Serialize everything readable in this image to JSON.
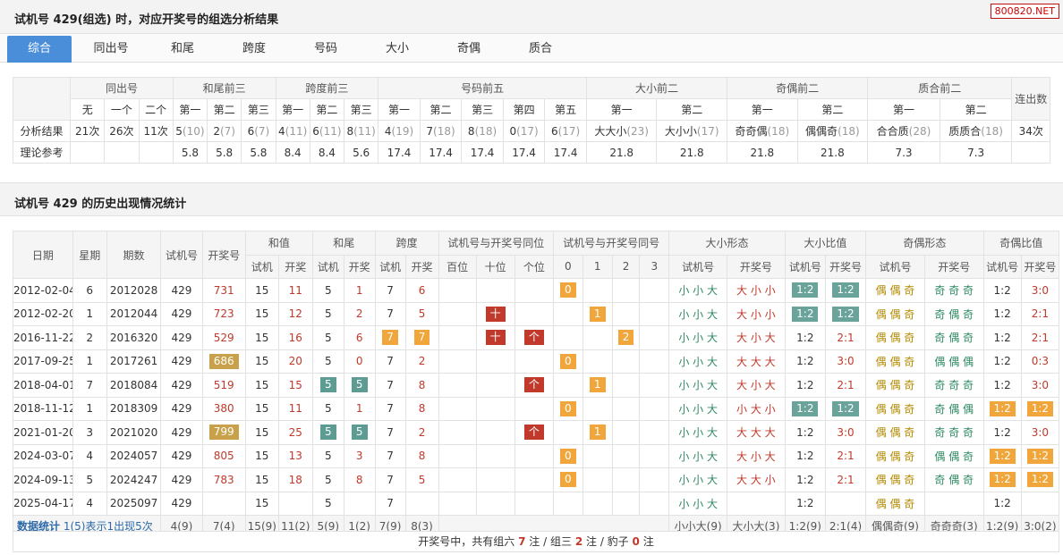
{
  "header": {
    "title": "试机号 429(组选) 时，对应开奖号的组选分析结果",
    "site": "800820.NET"
  },
  "tabs": [
    "综合",
    "同出号",
    "和尾",
    "跨度",
    "号码",
    "大小",
    "奇偶",
    "质合"
  ],
  "analysis": {
    "groups": [
      "同出号",
      "和尾前三",
      "跨度前三",
      "号码前五",
      "大小前二",
      "奇偶前二",
      "质合前二",
      "连出数"
    ],
    "sub": [
      "无",
      "一个",
      "二个",
      "第一",
      "第二",
      "第三",
      "第一",
      "第二",
      "第三",
      "第一",
      "第二",
      "第三",
      "第四",
      "第五",
      "第一",
      "第二",
      "第一",
      "第二",
      "第一",
      "第二"
    ],
    "row_label_result": "分析结果",
    "row_label_theory": "理论参考",
    "result": [
      {
        "v": "21次",
        "c": ""
      },
      {
        "v": "26次",
        "c": ""
      },
      {
        "v": "11次",
        "c": ""
      },
      {
        "v": "5",
        "c": "(10)"
      },
      {
        "v": "2",
        "c": "(7)"
      },
      {
        "v": "6",
        "c": "(7)"
      },
      {
        "v": "4",
        "c": "(11)"
      },
      {
        "v": "6",
        "c": "(11)"
      },
      {
        "v": "8",
        "c": "(11)"
      },
      {
        "v": "4",
        "c": "(19)"
      },
      {
        "v": "7",
        "c": "(18)"
      },
      {
        "v": "8",
        "c": "(18)"
      },
      {
        "v": "0",
        "c": "(17)"
      },
      {
        "v": "6",
        "c": "(17)"
      },
      {
        "v": "大大小",
        "c": "(23)"
      },
      {
        "v": "大小小",
        "c": "(17)"
      },
      {
        "v": "奇奇偶",
        "c": "(18)"
      },
      {
        "v": "偶偶奇",
        "c": "(18)"
      },
      {
        "v": "合合质",
        "c": "(28)"
      },
      {
        "v": "质质合",
        "c": "(18)"
      },
      {
        "v": "34次",
        "c": ""
      }
    ],
    "theory": [
      "",
      "",
      "",
      "5.8",
      "5.8",
      "5.8",
      "8.4",
      "8.4",
      "5.6",
      "17.4",
      "17.4",
      "17.4",
      "17.4",
      "17.4",
      "21.8",
      "21.8",
      "21.8",
      "21.8",
      "7.3",
      "7.3",
      ""
    ]
  },
  "history": {
    "title": "试机号 429 的历史出现情况统计",
    "head_top": [
      "日期",
      "星期",
      "期数",
      "试机号",
      "开奖号",
      "和值",
      "和尾",
      "跨度",
      "试机号与开奖号同位",
      "试机号与开奖号同号",
      "大小形态",
      "大小比值",
      "奇偶形态",
      "奇偶比值"
    ],
    "head_sub": [
      "试机",
      "开奖",
      "试机",
      "开奖",
      "试机",
      "开奖",
      "百位",
      "十位",
      "个位",
      "0",
      "1",
      "2",
      "3",
      "试机号",
      "开奖号",
      "试机号",
      "开奖号",
      "试机号",
      "开奖号",
      "试机号",
      "开奖号"
    ],
    "rows": [
      {
        "date": "2012-02-04",
        "wk": "6",
        "qi": "2012028",
        "sj": "429",
        "kj": "731",
        "kjhl": false,
        "hs": "15",
        "hk": "11",
        "ws": "5",
        "wk2": "1",
        "whl": false,
        "ks": "7",
        "kk": "6",
        "khl": false,
        "bai": "",
        "shi": "",
        "ge": "",
        "t0": "0",
        "t1": "",
        "t2": "",
        "t3": "",
        "dxs": "小 小 大",
        "dxk": "大 小 小",
        "dbs": "1:2",
        "dbk": "1:2",
        "dbhl": true,
        "jos": "偶 偶 奇",
        "jok": "奇 奇 奇",
        "jbs": "1:2",
        "jbk": "3:0",
        "jbhl": false
      },
      {
        "date": "2012-02-20",
        "wk": "1",
        "qi": "2012044",
        "sj": "429",
        "kj": "723",
        "kjhl": false,
        "hs": "15",
        "hk": "12",
        "ws": "5",
        "wk2": "2",
        "whl": false,
        "ks": "7",
        "kk": "5",
        "khl": false,
        "bai": "",
        "shi": "十",
        "ge": "",
        "t0": "",
        "t1": "1",
        "t2": "",
        "t3": "",
        "dxs": "小 小 大",
        "dxk": "大 小 小",
        "dbs": "1:2",
        "dbk": "1:2",
        "dbhl": true,
        "jos": "偶 偶 奇",
        "jok": "奇 偶 奇",
        "jbs": "1:2",
        "jbk": "2:1",
        "jbhl": false
      },
      {
        "date": "2016-11-22",
        "wk": "2",
        "qi": "2016320",
        "sj": "429",
        "kj": "529",
        "kjhl": false,
        "hs": "15",
        "hk": "16",
        "ws": "5",
        "wk2": "6",
        "whl": false,
        "ks": "7",
        "kk": "7",
        "khl": true,
        "bai": "",
        "shi": "十",
        "ge": "个",
        "t0": "",
        "t1": "",
        "t2": "2",
        "t3": "",
        "dxs": "小 小 大",
        "dxk": "大 小 大",
        "dbs": "1:2",
        "dbk": "2:1",
        "dbhl": false,
        "jos": "偶 偶 奇",
        "jok": "奇 偶 奇",
        "jbs": "1:2",
        "jbk": "2:1",
        "jbhl": false
      },
      {
        "date": "2017-09-25",
        "wk": "1",
        "qi": "2017261",
        "sj": "429",
        "kj": "686",
        "kjhl": true,
        "hs": "15",
        "hk": "20",
        "ws": "5",
        "wk2": "0",
        "whl": false,
        "ks": "7",
        "kk": "2",
        "khl": false,
        "bai": "",
        "shi": "",
        "ge": "",
        "t0": "0",
        "t1": "",
        "t2": "",
        "t3": "",
        "dxs": "小 小 大",
        "dxk": "大 大 大",
        "dbs": "1:2",
        "dbk": "3:0",
        "dbhl": false,
        "jos": "偶 偶 奇",
        "jok": "偶 偶 偶",
        "jbs": "1:2",
        "jbk": "0:3",
        "jbhl": false
      },
      {
        "date": "2018-04-01",
        "wk": "7",
        "qi": "2018084",
        "sj": "429",
        "kj": "519",
        "kjhl": false,
        "hs": "15",
        "hk": "15",
        "ws": "5",
        "wk2": "5",
        "whl": true,
        "ks": "7",
        "kk": "8",
        "khl": false,
        "bai": "",
        "shi": "",
        "ge": "个",
        "t0": "",
        "t1": "1",
        "t2": "",
        "t3": "",
        "dxs": "小 小 大",
        "dxk": "大 小 大",
        "dbs": "1:2",
        "dbk": "2:1",
        "dbhl": false,
        "jos": "偶 偶 奇",
        "jok": "奇 奇 奇",
        "jbs": "1:2",
        "jbk": "3:0",
        "jbhl": false
      },
      {
        "date": "2018-11-12",
        "wk": "1",
        "qi": "2018309",
        "sj": "429",
        "kj": "380",
        "kjhl": false,
        "hs": "15",
        "hk": "11",
        "ws": "5",
        "wk2": "1",
        "whl": false,
        "ks": "7",
        "kk": "8",
        "khl": false,
        "bai": "",
        "shi": "",
        "ge": "",
        "t0": "0",
        "t1": "",
        "t2": "",
        "t3": "",
        "dxs": "小 小 大",
        "dxk": "小 大 小",
        "dbs": "1:2",
        "dbk": "1:2",
        "dbhl": true,
        "jos": "偶 偶 奇",
        "jok": "奇 偶 偶",
        "jbs": "1:2",
        "jbk": "1:2",
        "jbhl": true
      },
      {
        "date": "2021-01-20",
        "wk": "3",
        "qi": "2021020",
        "sj": "429",
        "kj": "799",
        "kjhl": true,
        "hs": "15",
        "hk": "25",
        "ws": "5",
        "wk2": "5",
        "whl": true,
        "ks": "7",
        "kk": "2",
        "khl": false,
        "bai": "",
        "shi": "",
        "ge": "个",
        "t0": "",
        "t1": "1",
        "t2": "",
        "t3": "",
        "dxs": "小 小 大",
        "dxk": "大 大 大",
        "dbs": "1:2",
        "dbk": "3:0",
        "dbhl": false,
        "jos": "偶 偶 奇",
        "jok": "奇 奇 奇",
        "jbs": "1:2",
        "jbk": "3:0",
        "jbhl": false
      },
      {
        "date": "2024-03-07",
        "wk": "4",
        "qi": "2024057",
        "sj": "429",
        "kj": "805",
        "kjhl": false,
        "hs": "15",
        "hk": "13",
        "ws": "5",
        "wk2": "3",
        "whl": false,
        "ks": "7",
        "kk": "8",
        "khl": false,
        "bai": "",
        "shi": "",
        "ge": "",
        "t0": "0",
        "t1": "",
        "t2": "",
        "t3": "",
        "dxs": "小 小 大",
        "dxk": "大 小 大",
        "dbs": "1:2",
        "dbk": "2:1",
        "dbhl": false,
        "jos": "偶 偶 奇",
        "jok": "偶 偶 奇",
        "jbs": "1:2",
        "jbk": "1:2",
        "jbhl": true
      },
      {
        "date": "2024-09-13",
        "wk": "5",
        "qi": "2024247",
        "sj": "429",
        "kj": "783",
        "kjhl": false,
        "hs": "15",
        "hk": "18",
        "ws": "5",
        "wk2": "8",
        "whl": false,
        "ks": "7",
        "kk": "5",
        "khl": false,
        "bai": "",
        "shi": "",
        "ge": "",
        "t0": "0",
        "t1": "",
        "t2": "",
        "t3": "",
        "dxs": "小 小 大",
        "dxk": "大 大 小",
        "dbs": "1:2",
        "dbk": "2:1",
        "dbhl": false,
        "jos": "偶 偶 奇",
        "jok": "奇 偶 奇",
        "jbs": "1:2",
        "jbk": "1:2",
        "jbhl": true
      },
      {
        "date": "2025-04-17",
        "wk": "4",
        "qi": "2025097",
        "sj": "429",
        "kj": "",
        "kjhl": false,
        "hs": "15",
        "hk": "",
        "ws": "5",
        "wk2": "",
        "whl": false,
        "ks": "7",
        "kk": "",
        "khl": false,
        "bai": "",
        "shi": "",
        "ge": "",
        "t0": "",
        "t1": "",
        "t2": "",
        "t3": "",
        "dxs": "小 小 大",
        "dxk": "",
        "dbs": "1:2",
        "dbk": "",
        "dbhl": false,
        "jos": "偶 偶 奇",
        "jok": "",
        "jbs": "1:2",
        "jbk": "",
        "jbhl": false
      }
    ],
    "stats": {
      "label": "数据统计",
      "note": "1(5)表示1出现5次",
      "wk": "4(9)",
      "kj": "7(4)",
      "hs": "15(9)",
      "hk": "11(2)",
      "ws": "5(9)",
      "wk2": "1(2)",
      "ks": "7(9)",
      "kk": "8(3)",
      "dxs": "小小大(9)",
      "dxk": "大小大(3)",
      "dbs": "1:2(9)",
      "dbk": "2:1(4)",
      "jos": "偶偶奇(9)",
      "jok": "奇奇奇(3)",
      "jbs": "1:2(9)",
      "jbk": "3:0(2)"
    }
  },
  "footer": {
    "pre": "开奖号中，共有组六",
    "n1": "7",
    "mid1": "注 / 组三",
    "n2": "2",
    "mid2": "注 / 豹子",
    "n3": "0",
    "post": "注"
  }
}
